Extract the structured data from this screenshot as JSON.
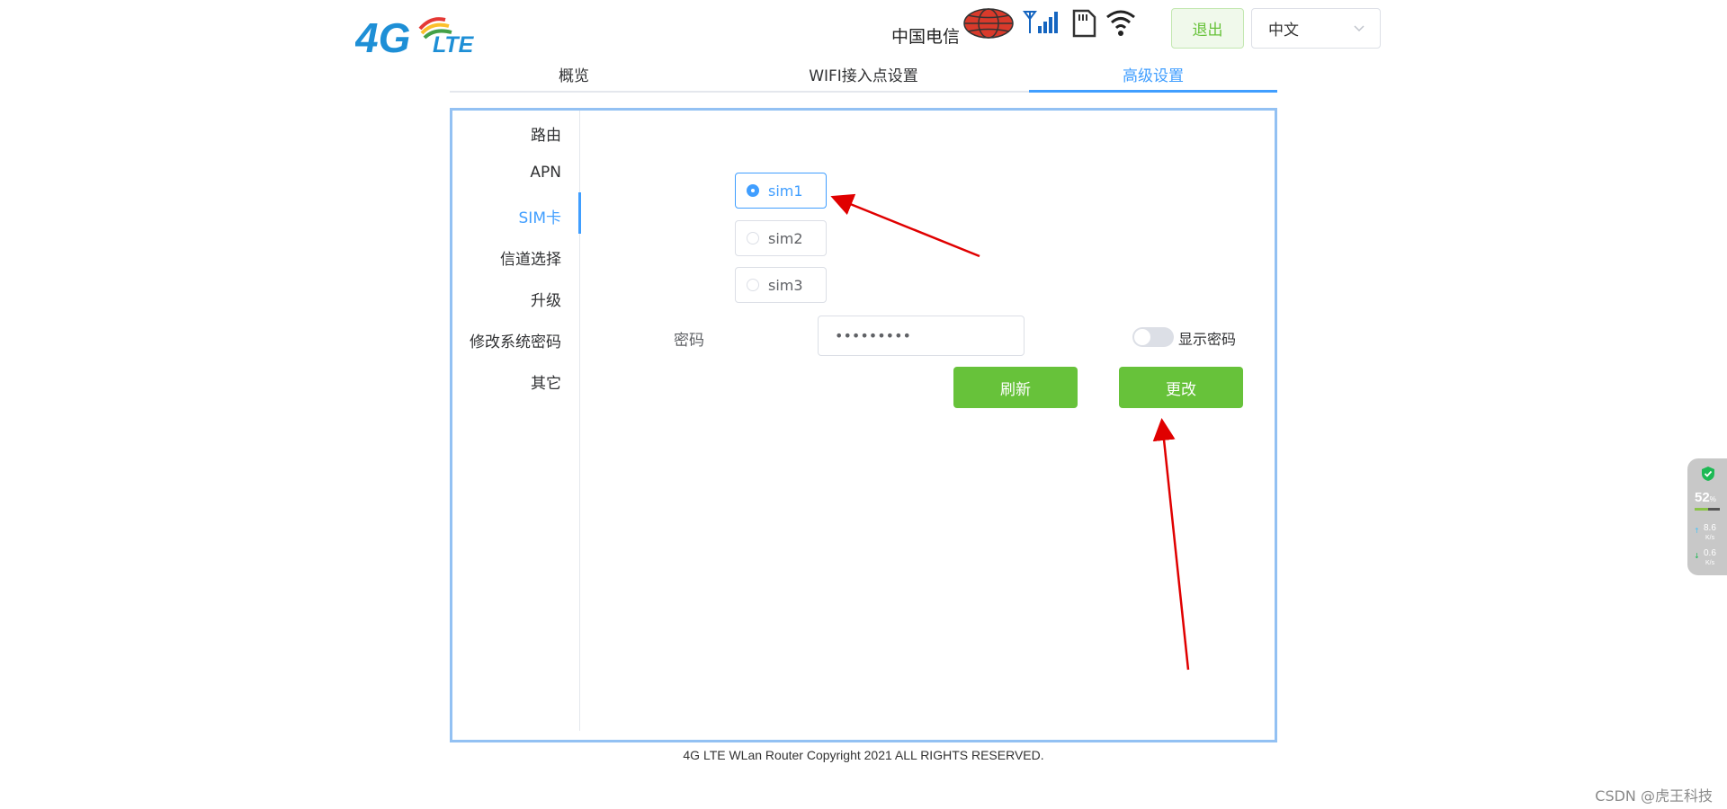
{
  "header": {
    "logo_text": "4G LTE",
    "carrier": "中国电信",
    "icons": [
      "globe-icon",
      "signal-icon",
      "sim-card-icon",
      "wifi-icon"
    ],
    "logout_label": "退出",
    "language_value": "中文"
  },
  "tabs": [
    {
      "label": "概览",
      "active": false
    },
    {
      "label": "WIFI接入点设置",
      "active": false
    },
    {
      "label": "高级设置",
      "active": true
    }
  ],
  "sidebar": {
    "items": [
      {
        "label": "路由",
        "active": false
      },
      {
        "label": "APN",
        "active": false
      },
      {
        "label": "SIM卡",
        "active": true
      },
      {
        "label": "信道选择",
        "active": false
      },
      {
        "label": "升级",
        "active": false
      },
      {
        "label": "修改系统密码",
        "active": false
      },
      {
        "label": "其它",
        "active": false
      }
    ]
  },
  "sim": {
    "options": [
      {
        "label": "sim1",
        "checked": true
      },
      {
        "label": "sim2",
        "checked": false
      },
      {
        "label": "sim3",
        "checked": false
      }
    ],
    "password_label": "密码",
    "password_value": "•••••••••",
    "show_password_label": "显示密码",
    "show_password_on": false,
    "refresh_label": "刷新",
    "change_label": "更改"
  },
  "footer": {
    "copyright": "4G LTE WLan Router Copyright 2021 ALL RIGHTS RESERVED."
  },
  "watermark": "CSDN @虎王科技",
  "widget": {
    "percent": "52",
    "percent_unit": "%",
    "usage_fraction": 0.52,
    "upload": "8.6",
    "upload_unit": "K/s",
    "download": "0.6",
    "download_unit": "K/s"
  },
  "colors": {
    "accent": "#409eff",
    "success": "#67c23a",
    "panel_border": "#93c1f3",
    "annotation": "#e00000"
  }
}
